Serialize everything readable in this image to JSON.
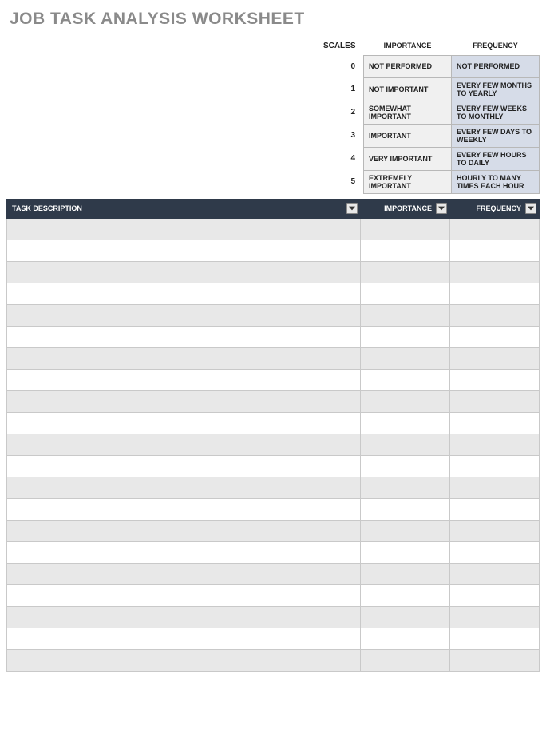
{
  "title": "JOB TASK ANALYSIS WORKSHEET",
  "scales": {
    "header": {
      "scales": "SCALES",
      "importance": "IMPORTANCE",
      "frequency": "FREQUENCY"
    },
    "rows": [
      {
        "num": "0",
        "importance": "NOT PERFORMED",
        "frequency": "NOT PERFORMED"
      },
      {
        "num": "1",
        "importance": "NOT IMPORTANT",
        "frequency": "EVERY FEW MONTHS TO YEARLY"
      },
      {
        "num": "2",
        "importance": "SOMEWHAT IMPORTANT",
        "frequency": "EVERY FEW WEEKS TO MONTHLY"
      },
      {
        "num": "3",
        "importance": "IMPORTANT",
        "frequency": "EVERY FEW DAYS TO WEEKLY"
      },
      {
        "num": "4",
        "importance": "VERY IMPORTANT",
        "frequency": "EVERY FEW HOURS TO DAILY"
      },
      {
        "num": "5",
        "importance": "EXTREMELY IMPORTANT",
        "frequency": "HOURLY TO MANY TIMES EACH HOUR"
      }
    ]
  },
  "table": {
    "headers": {
      "task": "TASK DESCRIPTION",
      "importance": "IMPORTANCE",
      "frequency": "FREQUENCY"
    },
    "rows": [
      {
        "task": "",
        "importance": "",
        "frequency": ""
      },
      {
        "task": "",
        "importance": "",
        "frequency": ""
      },
      {
        "task": "",
        "importance": "",
        "frequency": ""
      },
      {
        "task": "",
        "importance": "",
        "frequency": ""
      },
      {
        "task": "",
        "importance": "",
        "frequency": ""
      },
      {
        "task": "",
        "importance": "",
        "frequency": ""
      },
      {
        "task": "",
        "importance": "",
        "frequency": ""
      },
      {
        "task": "",
        "importance": "",
        "frequency": ""
      },
      {
        "task": "",
        "importance": "",
        "frequency": ""
      },
      {
        "task": "",
        "importance": "",
        "frequency": ""
      },
      {
        "task": "",
        "importance": "",
        "frequency": ""
      },
      {
        "task": "",
        "importance": "",
        "frequency": ""
      },
      {
        "task": "",
        "importance": "",
        "frequency": ""
      },
      {
        "task": "",
        "importance": "",
        "frequency": ""
      },
      {
        "task": "",
        "importance": "",
        "frequency": ""
      },
      {
        "task": "",
        "importance": "",
        "frequency": ""
      },
      {
        "task": "",
        "importance": "",
        "frequency": ""
      },
      {
        "task": "",
        "importance": "",
        "frequency": ""
      },
      {
        "task": "",
        "importance": "",
        "frequency": ""
      },
      {
        "task": "",
        "importance": "",
        "frequency": ""
      },
      {
        "task": "",
        "importance": "",
        "frequency": ""
      }
    ]
  }
}
